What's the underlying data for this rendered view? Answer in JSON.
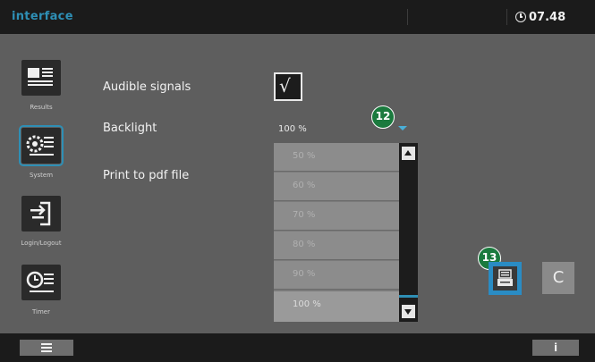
{
  "header": {
    "title": "interface",
    "time": "07.48",
    "clock_icon": "clock-icon"
  },
  "sidebar": {
    "items": [
      {
        "label": "Results",
        "icon": "results-icon"
      },
      {
        "label": "System",
        "icon": "system-settings-icon",
        "active": true
      },
      {
        "label": "Login/Logout",
        "icon": "login-logout-icon"
      },
      {
        "label": "Timer",
        "icon": "timer-icon"
      }
    ]
  },
  "settings": {
    "audible_signals": {
      "label": "Audible signals",
      "checked": true,
      "check_glyph": "√"
    },
    "backlight": {
      "label": "Backlight",
      "value": "100 %"
    },
    "print_to_pdf": {
      "label": "Print to pdf file"
    }
  },
  "dropdown": {
    "options": [
      "50 %",
      "60 %",
      "70 %",
      "80 %",
      "90 %",
      "100 %"
    ],
    "selected": "100 %"
  },
  "callouts": [
    "12",
    "13"
  ],
  "buttons": {
    "print_icon": "print-pdf-icon",
    "cancel_label": "C"
  },
  "footer": {
    "menu_icon": "menu-icon",
    "info_label": "i"
  },
  "colors": {
    "accent": "#2e8fb5",
    "callout": "#1b7a3e"
  }
}
